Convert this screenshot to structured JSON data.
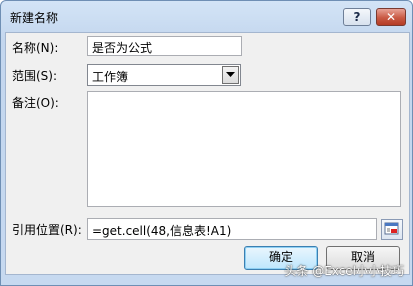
{
  "dialog": {
    "title": "新建名称",
    "help_label": "?",
    "close_label": "✕"
  },
  "form": {
    "name_label": "名称(N):",
    "name_value": "是否为公式",
    "scope_label": "范围(S):",
    "scope_value": "工作簿",
    "comment_label": "备注(O):",
    "comment_value": "",
    "refers_to_label": "引用位置(R):",
    "refers_to_value": "=get.cell(48,信息表!A1)"
  },
  "buttons": {
    "ok_label": "确定",
    "cancel_label": "取消"
  },
  "icons": {
    "dropdown": "chevron-down-icon",
    "range_select": "collapse-dialog-icon"
  },
  "watermark": "头条 @Excel小小技巧"
}
